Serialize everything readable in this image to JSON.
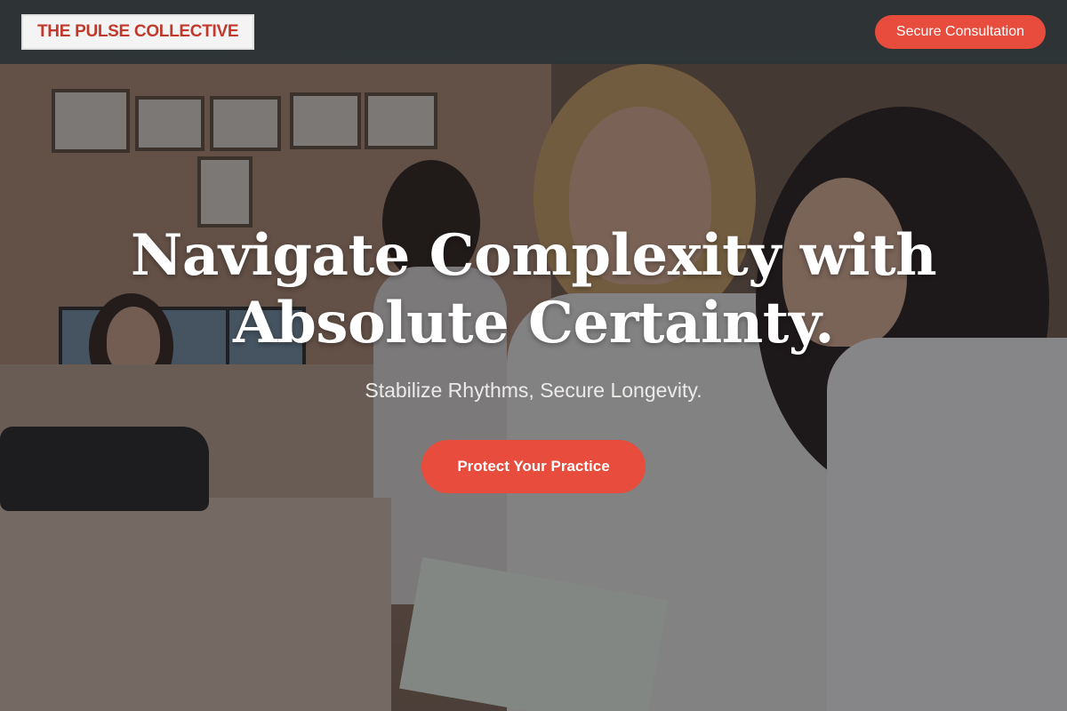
{
  "brand": {
    "logo_text": "THE PULSE COLLECTIVE",
    "accent_color": "#e74c3c",
    "logo_color": "#c0392b"
  },
  "navbar": {
    "cta_label": "Secure Consultation"
  },
  "hero": {
    "headline_line1": "Navigate Complexity with",
    "headline_line2": "Absolute Certainty.",
    "subheadline": "Stabilize Rhythms, Secure Longevity.",
    "cta_label": "Protect Your Practice",
    "background_image": "medical-staff-reviewing-chart-photo"
  }
}
